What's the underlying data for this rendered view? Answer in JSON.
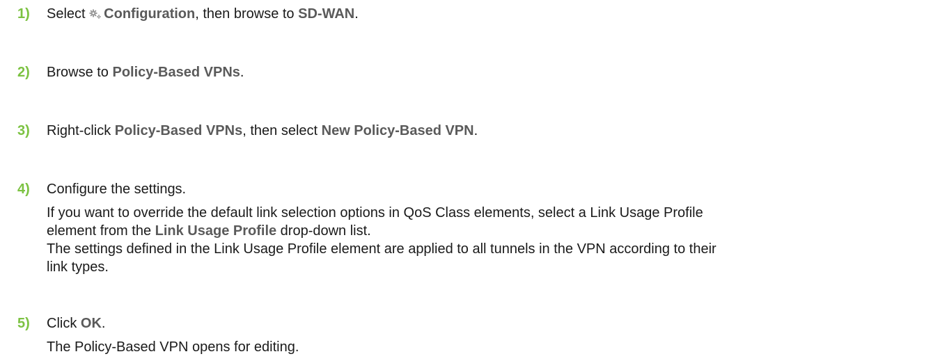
{
  "steps": [
    {
      "number": "1)",
      "t1": "Select ",
      "b1": "Configuration",
      "t2": ", then browse to ",
      "b2": "SD-WAN",
      "t3": "."
    },
    {
      "number": "2)",
      "t1": "Browse to ",
      "b1": "Policy-Based VPNs",
      "t2": "."
    },
    {
      "number": "3)",
      "t1": "Right-click ",
      "b1": "Policy-Based VPNs",
      "t2": ", then select ",
      "b2": "New Policy-Based VPN",
      "t3": "."
    },
    {
      "number": "4)",
      "t1": "Configure the settings.",
      "sub1_t1": "If you want to override the default link selection options in QoS Class elements, select a Link Usage Profile",
      "sub1_t2": "element from the ",
      "sub1_b1": "Link Usage Profile",
      "sub1_t3": " drop-down list.",
      "sub2_l1": "The settings defined in the Link Usage Profile element are applied to all tunnels in the VPN according to their",
      "sub2_l2": "link types."
    },
    {
      "number": "5)",
      "t1": "Click ",
      "b1": "OK",
      "t2": ".",
      "sub1": "The Policy-Based VPN opens for editing."
    }
  ],
  "icons": {
    "configuration": "gear-icon"
  },
  "colors": {
    "step_number": "#7cc242",
    "ui_term": "#5a5a5a",
    "body_text": "#1a1a1a"
  }
}
